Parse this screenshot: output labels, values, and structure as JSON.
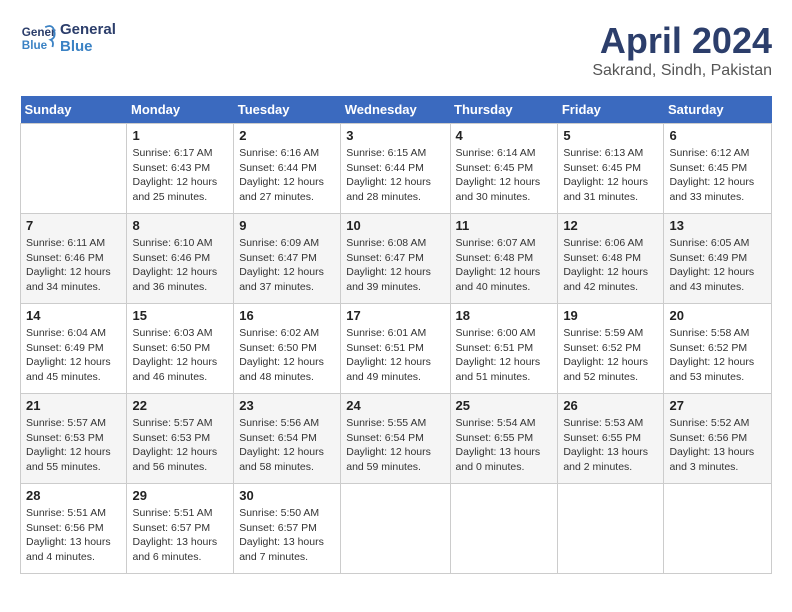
{
  "header": {
    "logo_line1": "General",
    "logo_line2": "Blue",
    "title": "April 2024",
    "subtitle": "Sakrand, Sindh, Pakistan"
  },
  "columns": [
    "Sunday",
    "Monday",
    "Tuesday",
    "Wednesday",
    "Thursday",
    "Friday",
    "Saturday"
  ],
  "weeks": [
    [
      {
        "day": "",
        "sunrise": "",
        "sunset": "",
        "daylight": ""
      },
      {
        "day": "1",
        "sunrise": "Sunrise: 6:17 AM",
        "sunset": "Sunset: 6:43 PM",
        "daylight": "Daylight: 12 hours and 25 minutes."
      },
      {
        "day": "2",
        "sunrise": "Sunrise: 6:16 AM",
        "sunset": "Sunset: 6:44 PM",
        "daylight": "Daylight: 12 hours and 27 minutes."
      },
      {
        "day": "3",
        "sunrise": "Sunrise: 6:15 AM",
        "sunset": "Sunset: 6:44 PM",
        "daylight": "Daylight: 12 hours and 28 minutes."
      },
      {
        "day": "4",
        "sunrise": "Sunrise: 6:14 AM",
        "sunset": "Sunset: 6:45 PM",
        "daylight": "Daylight: 12 hours and 30 minutes."
      },
      {
        "day": "5",
        "sunrise": "Sunrise: 6:13 AM",
        "sunset": "Sunset: 6:45 PM",
        "daylight": "Daylight: 12 hours and 31 minutes."
      },
      {
        "day": "6",
        "sunrise": "Sunrise: 6:12 AM",
        "sunset": "Sunset: 6:45 PM",
        "daylight": "Daylight: 12 hours and 33 minutes."
      }
    ],
    [
      {
        "day": "7",
        "sunrise": "Sunrise: 6:11 AM",
        "sunset": "Sunset: 6:46 PM",
        "daylight": "Daylight: 12 hours and 34 minutes."
      },
      {
        "day": "8",
        "sunrise": "Sunrise: 6:10 AM",
        "sunset": "Sunset: 6:46 PM",
        "daylight": "Daylight: 12 hours and 36 minutes."
      },
      {
        "day": "9",
        "sunrise": "Sunrise: 6:09 AM",
        "sunset": "Sunset: 6:47 PM",
        "daylight": "Daylight: 12 hours and 37 minutes."
      },
      {
        "day": "10",
        "sunrise": "Sunrise: 6:08 AM",
        "sunset": "Sunset: 6:47 PM",
        "daylight": "Daylight: 12 hours and 39 minutes."
      },
      {
        "day": "11",
        "sunrise": "Sunrise: 6:07 AM",
        "sunset": "Sunset: 6:48 PM",
        "daylight": "Daylight: 12 hours and 40 minutes."
      },
      {
        "day": "12",
        "sunrise": "Sunrise: 6:06 AM",
        "sunset": "Sunset: 6:48 PM",
        "daylight": "Daylight: 12 hours and 42 minutes."
      },
      {
        "day": "13",
        "sunrise": "Sunrise: 6:05 AM",
        "sunset": "Sunset: 6:49 PM",
        "daylight": "Daylight: 12 hours and 43 minutes."
      }
    ],
    [
      {
        "day": "14",
        "sunrise": "Sunrise: 6:04 AM",
        "sunset": "Sunset: 6:49 PM",
        "daylight": "Daylight: 12 hours and 45 minutes."
      },
      {
        "day": "15",
        "sunrise": "Sunrise: 6:03 AM",
        "sunset": "Sunset: 6:50 PM",
        "daylight": "Daylight: 12 hours and 46 minutes."
      },
      {
        "day": "16",
        "sunrise": "Sunrise: 6:02 AM",
        "sunset": "Sunset: 6:50 PM",
        "daylight": "Daylight: 12 hours and 48 minutes."
      },
      {
        "day": "17",
        "sunrise": "Sunrise: 6:01 AM",
        "sunset": "Sunset: 6:51 PM",
        "daylight": "Daylight: 12 hours and 49 minutes."
      },
      {
        "day": "18",
        "sunrise": "Sunrise: 6:00 AM",
        "sunset": "Sunset: 6:51 PM",
        "daylight": "Daylight: 12 hours and 51 minutes."
      },
      {
        "day": "19",
        "sunrise": "Sunrise: 5:59 AM",
        "sunset": "Sunset: 6:52 PM",
        "daylight": "Daylight: 12 hours and 52 minutes."
      },
      {
        "day": "20",
        "sunrise": "Sunrise: 5:58 AM",
        "sunset": "Sunset: 6:52 PM",
        "daylight": "Daylight: 12 hours and 53 minutes."
      }
    ],
    [
      {
        "day": "21",
        "sunrise": "Sunrise: 5:57 AM",
        "sunset": "Sunset: 6:53 PM",
        "daylight": "Daylight: 12 hours and 55 minutes."
      },
      {
        "day": "22",
        "sunrise": "Sunrise: 5:57 AM",
        "sunset": "Sunset: 6:53 PM",
        "daylight": "Daylight: 12 hours and 56 minutes."
      },
      {
        "day": "23",
        "sunrise": "Sunrise: 5:56 AM",
        "sunset": "Sunset: 6:54 PM",
        "daylight": "Daylight: 12 hours and 58 minutes."
      },
      {
        "day": "24",
        "sunrise": "Sunrise: 5:55 AM",
        "sunset": "Sunset: 6:54 PM",
        "daylight": "Daylight: 12 hours and 59 minutes."
      },
      {
        "day": "25",
        "sunrise": "Sunrise: 5:54 AM",
        "sunset": "Sunset: 6:55 PM",
        "daylight": "Daylight: 13 hours and 0 minutes."
      },
      {
        "day": "26",
        "sunrise": "Sunrise: 5:53 AM",
        "sunset": "Sunset: 6:55 PM",
        "daylight": "Daylight: 13 hours and 2 minutes."
      },
      {
        "day": "27",
        "sunrise": "Sunrise: 5:52 AM",
        "sunset": "Sunset: 6:56 PM",
        "daylight": "Daylight: 13 hours and 3 minutes."
      }
    ],
    [
      {
        "day": "28",
        "sunrise": "Sunrise: 5:51 AM",
        "sunset": "Sunset: 6:56 PM",
        "daylight": "Daylight: 13 hours and 4 minutes."
      },
      {
        "day": "29",
        "sunrise": "Sunrise: 5:51 AM",
        "sunset": "Sunset: 6:57 PM",
        "daylight": "Daylight: 13 hours and 6 minutes."
      },
      {
        "day": "30",
        "sunrise": "Sunrise: 5:50 AM",
        "sunset": "Sunset: 6:57 PM",
        "daylight": "Daylight: 13 hours and 7 minutes."
      },
      {
        "day": "",
        "sunrise": "",
        "sunset": "",
        "daylight": ""
      },
      {
        "day": "",
        "sunrise": "",
        "sunset": "",
        "daylight": ""
      },
      {
        "day": "",
        "sunrise": "",
        "sunset": "",
        "daylight": ""
      },
      {
        "day": "",
        "sunrise": "",
        "sunset": "",
        "daylight": ""
      }
    ]
  ]
}
